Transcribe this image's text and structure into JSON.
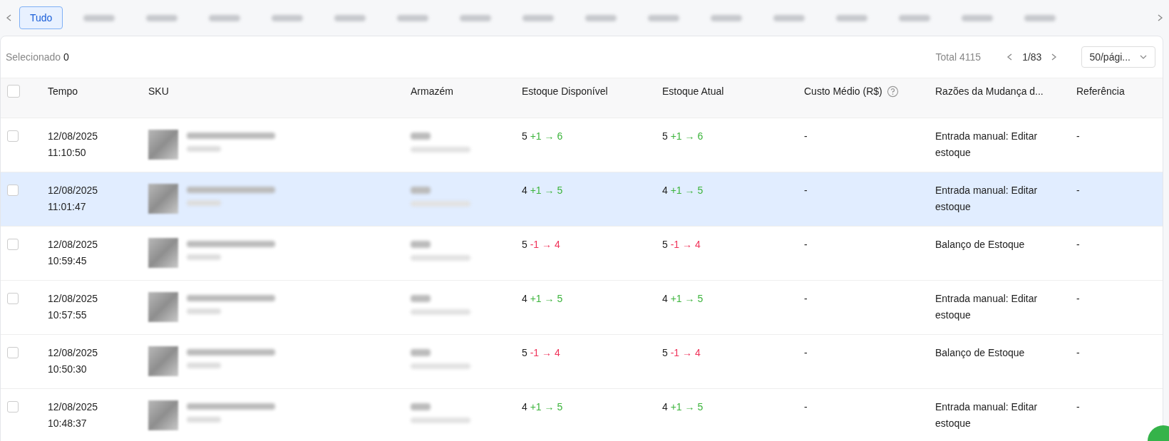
{
  "tabs": [
    {
      "label": "Tudo",
      "selected": true,
      "blurred": false
    },
    {
      "selected": false,
      "blurred": true
    },
    {
      "selected": false,
      "blurred": true
    },
    {
      "selected": false,
      "blurred": true
    },
    {
      "selected": false,
      "blurred": true
    },
    {
      "selected": false,
      "blurred": true
    },
    {
      "selected": false,
      "blurred": true
    },
    {
      "selected": false,
      "blurred": true
    },
    {
      "selected": false,
      "blurred": true
    },
    {
      "selected": false,
      "blurred": true
    },
    {
      "selected": false,
      "blurred": true
    },
    {
      "selected": false,
      "blurred": true
    },
    {
      "selected": false,
      "blurred": true
    },
    {
      "selected": false,
      "blurred": true
    },
    {
      "selected": false,
      "blurred": true
    },
    {
      "selected": false,
      "blurred": true
    },
    {
      "selected": false,
      "blurred": true
    }
  ],
  "toolbar": {
    "selected_label": "Selecionado",
    "selected_count": "0",
    "total": "Total 4115",
    "page": "1/83",
    "page_size": "50/pági..."
  },
  "table": {
    "select_all_checked": false,
    "columns": [
      "Tempo",
      "SKU",
      "Armazém",
      "Estoque Disponível",
      "Estoque Atual",
      "Custo Médio (R$)",
      "Razões da Mudança d...",
      "Referência"
    ],
    "rows": [
      {
        "checked": false,
        "highlighted": false,
        "date": "12/08/2025",
        "time": "11:10:50",
        "available": {
          "before": "5",
          "kind": "up",
          "change": "+1 → 6"
        },
        "current": {
          "before": "5",
          "kind": "up",
          "change": "+1 → 6"
        },
        "cost": "-",
        "reason": "Entrada manual: Editar estoque",
        "reference": "-"
      },
      {
        "checked": false,
        "highlighted": true,
        "date": "12/08/2025",
        "time": "11:01:47",
        "available": {
          "before": "4",
          "kind": "up",
          "change": "+1 → 5"
        },
        "current": {
          "before": "4",
          "kind": "up",
          "change": "+1 → 5"
        },
        "cost": "-",
        "reason": "Entrada manual: Editar estoque",
        "reference": "-"
      },
      {
        "checked": false,
        "highlighted": false,
        "date": "12/08/2025",
        "time": "10:59:45",
        "available": {
          "before": "5",
          "kind": "down",
          "change": "-1 → 4"
        },
        "current": {
          "before": "5",
          "kind": "down",
          "change": "-1 → 4"
        },
        "cost": "-",
        "reason": "Balanço de Estoque",
        "reference": "-"
      },
      {
        "checked": false,
        "highlighted": false,
        "date": "12/08/2025",
        "time": "10:57:55",
        "available": {
          "before": "4",
          "kind": "up",
          "change": "+1 → 5"
        },
        "current": {
          "before": "4",
          "kind": "up",
          "change": "+1 → 5"
        },
        "cost": "-",
        "reason": "Entrada manual: Editar estoque",
        "reference": "-"
      },
      {
        "checked": false,
        "highlighted": false,
        "date": "12/08/2025",
        "time": "10:50:30",
        "available": {
          "before": "5",
          "kind": "down",
          "change": "-1 → 4"
        },
        "current": {
          "before": "5",
          "kind": "down",
          "change": "-1 → 4"
        },
        "cost": "-",
        "reason": "Balanço de Estoque",
        "reference": "-"
      },
      {
        "checked": false,
        "highlighted": false,
        "date": "12/08/2025",
        "time": "10:48:37",
        "available": {
          "before": "4",
          "kind": "up",
          "change": "+1 → 5"
        },
        "current": {
          "before": "4",
          "kind": "up",
          "change": "+1 → 5"
        },
        "cost": "-",
        "reason": "Entrada manual: Editar estoque",
        "reference": "-"
      }
    ]
  }
}
